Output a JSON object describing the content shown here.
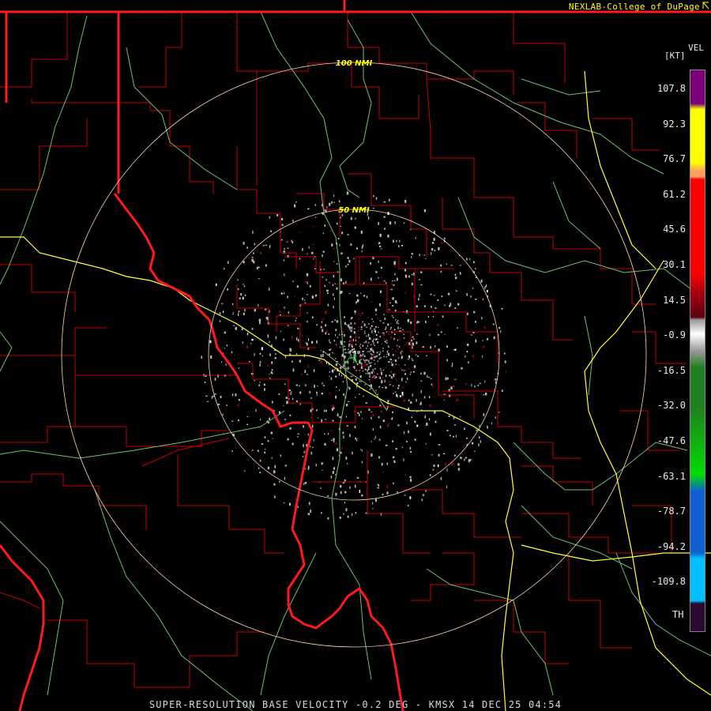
{
  "header": {
    "credit": "NEXLAB-College of DuPage",
    "credit_icon": "corner-arrow-icon"
  },
  "footer": {
    "caption": "SUPER-RESOLUTION BASE VELOCITY -0.2 DEG - KMSX 14 DEC 25 04:54"
  },
  "map": {
    "range_rings": [
      {
        "label": "50 NMI",
        "nmi": 50
      },
      {
        "label": "100 NMI",
        "nmi": 100
      }
    ],
    "colors": {
      "background": "#000000",
      "state_border": "#ff1a1a",
      "county_border": "#c40000",
      "interstate": "#ffff33",
      "highway": "#6fbf6f",
      "range_ring": "#ffd8b0",
      "ring_label": "#ffff00",
      "echo_primary": "#b8b8b8"
    }
  },
  "legend": {
    "product": "VEL",
    "units": "[KT]",
    "ticks": [
      "107.8",
      "92.3",
      "76.7",
      "61.2",
      "45.6",
      "30.1",
      "14.5",
      "-0.9",
      "-16.5",
      "-32.0",
      "-47.6",
      "-63.1",
      "-78.7",
      "-94.2",
      "-109.8"
    ],
    "threshold": "TH",
    "scale_colors": [
      "#7a007a",
      "#ffff00",
      "#ffa060",
      "#ff0000",
      "#a00010",
      "#5a0010",
      "#9a9a9a",
      "#ffffff",
      "#208020",
      "#00dd00",
      "#1060d0",
      "#00c0ff",
      "#2a0a30"
    ]
  }
}
